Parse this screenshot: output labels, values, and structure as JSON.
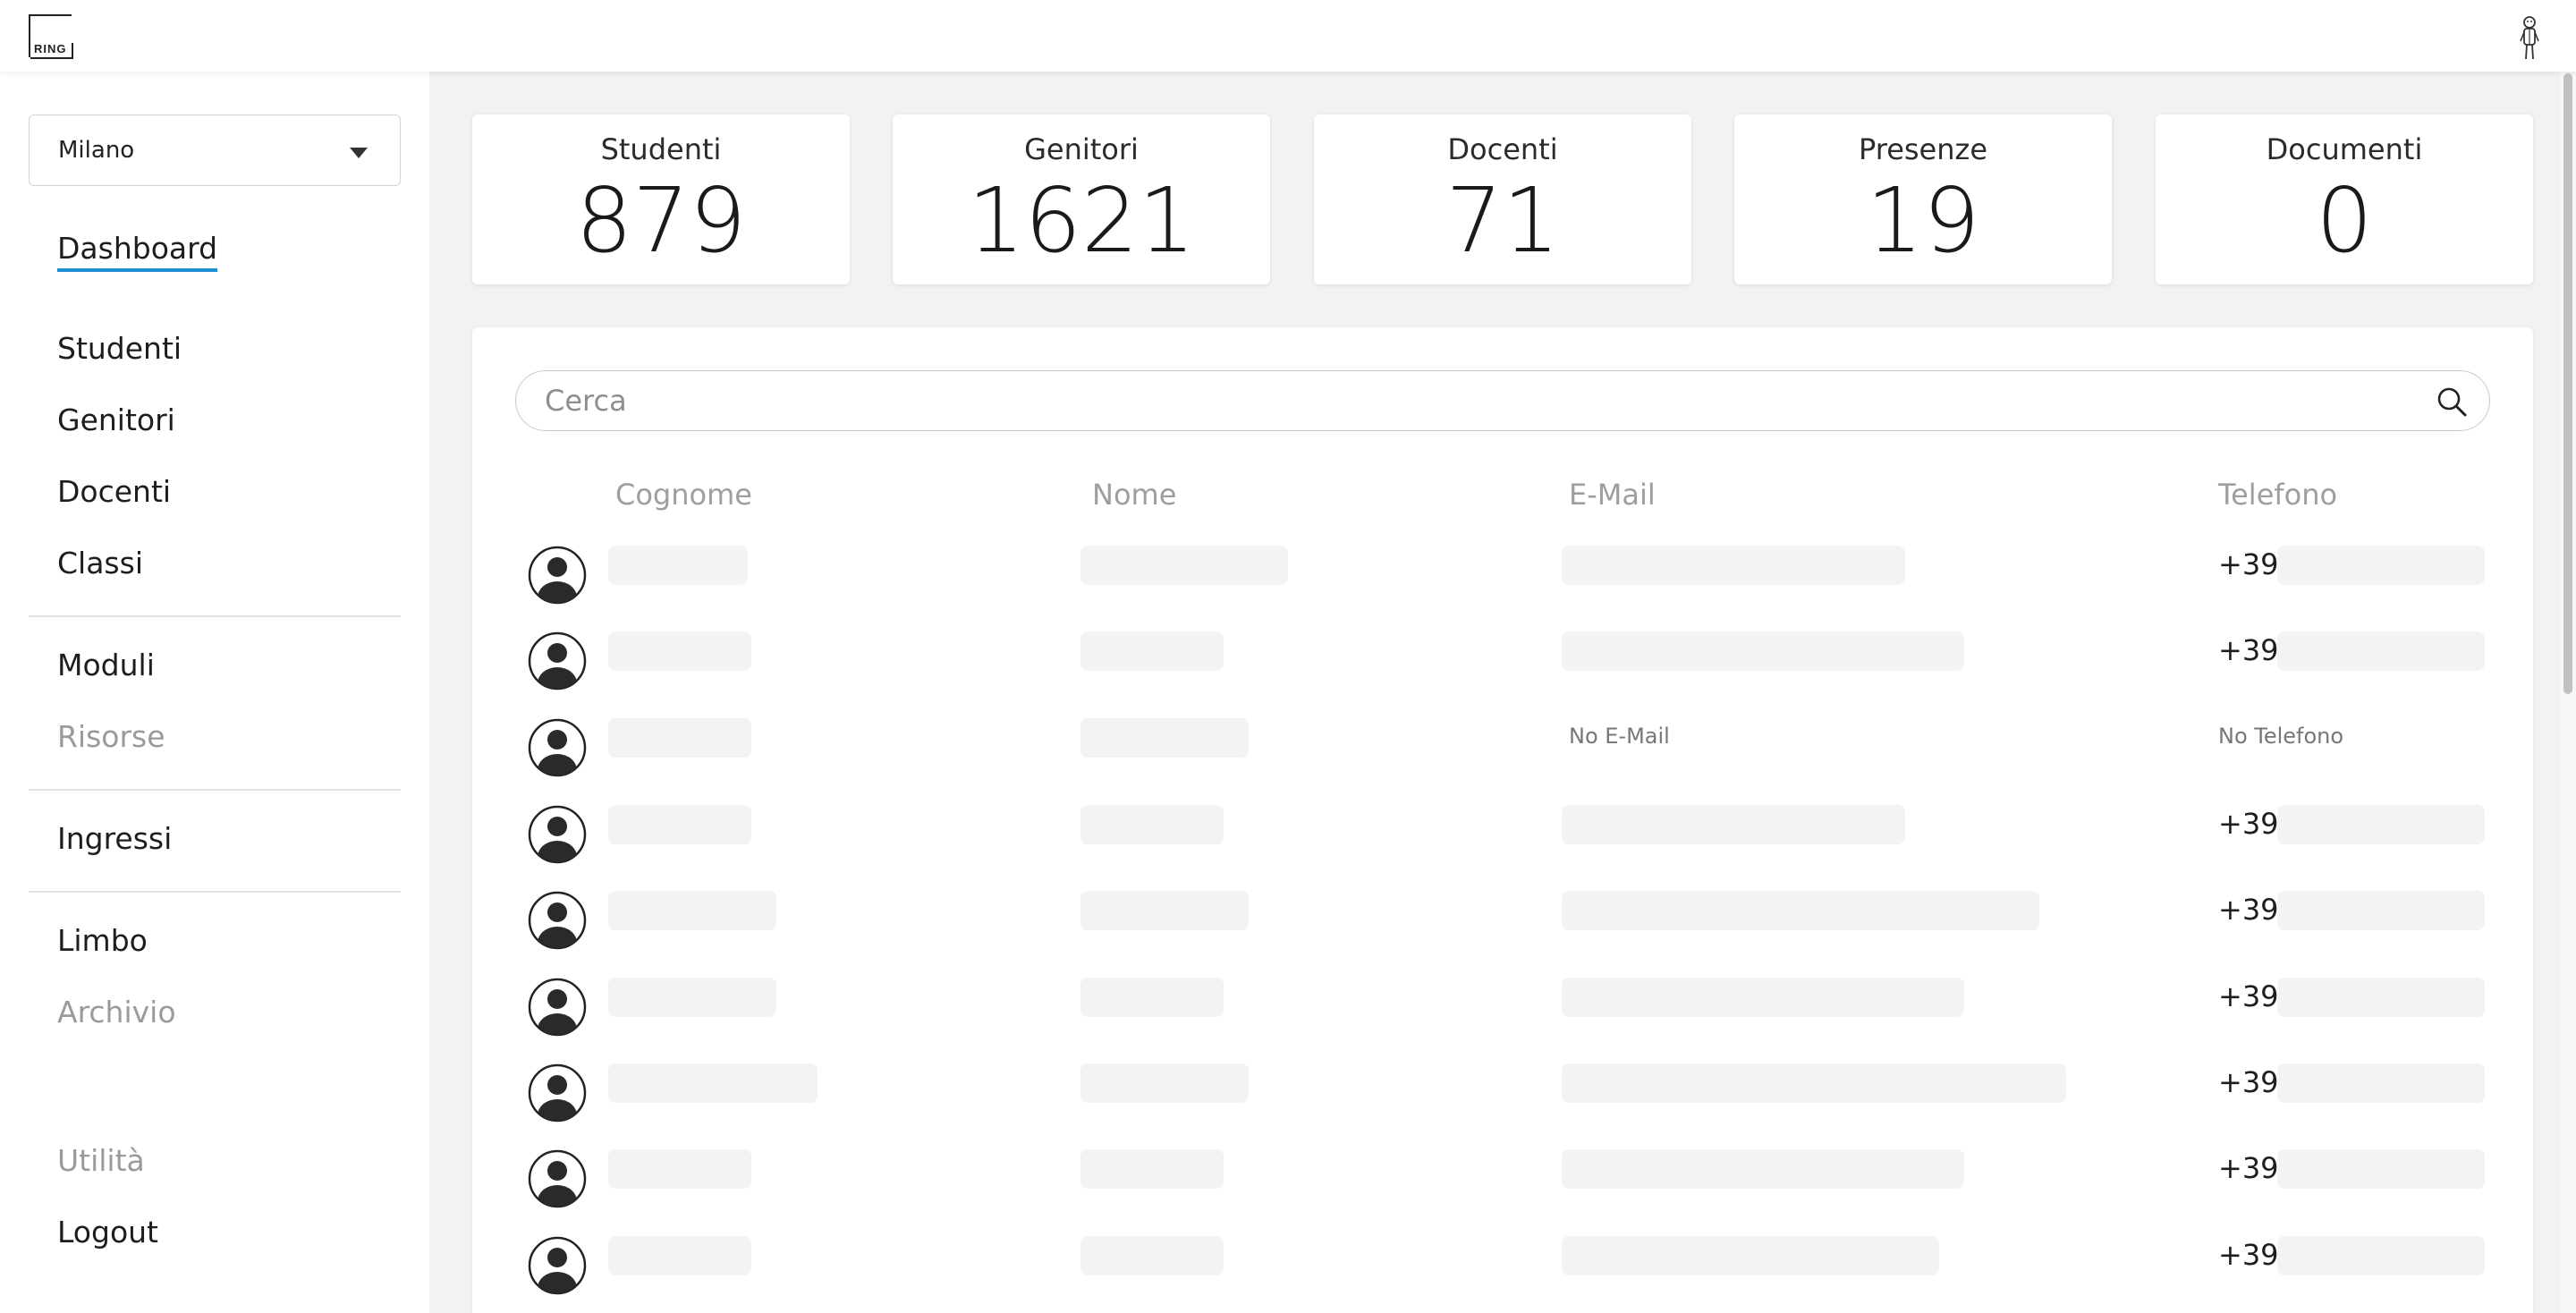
{
  "header": {
    "logo_text": "RING"
  },
  "sidebar": {
    "city": "Milano",
    "items": [
      {
        "label": "Dashboard"
      },
      {
        "label": "Studenti"
      },
      {
        "label": "Genitori"
      },
      {
        "label": "Docenti"
      },
      {
        "label": "Classi"
      },
      {
        "label": "Moduli"
      },
      {
        "label": "Risorse"
      },
      {
        "label": "Ingressi"
      },
      {
        "label": "Limbo"
      },
      {
        "label": "Archivio"
      },
      {
        "label": "Utilità"
      },
      {
        "label": "Logout"
      }
    ]
  },
  "stats": [
    {
      "label": "Studenti",
      "value": "879"
    },
    {
      "label": "Genitori",
      "value": "1621"
    },
    {
      "label": "Docenti",
      "value": "71"
    },
    {
      "label": "Presenze",
      "value": "19"
    },
    {
      "label": "Documenti",
      "value": "0"
    }
  ],
  "search": {
    "placeholder": "Cerca"
  },
  "table": {
    "columns": [
      "Cognome",
      "Nome",
      "E-Mail",
      "Telefono"
    ],
    "rows": [
      {
        "email": "",
        "phone_prefix": "+39"
      },
      {
        "email": "",
        "phone_prefix": "+39"
      },
      {
        "email": "No E-Mail",
        "phone_prefix": "No Telefono"
      },
      {
        "email": "",
        "phone_prefix": "+39"
      },
      {
        "email": "",
        "phone_prefix": "+39"
      },
      {
        "email": "",
        "phone_prefix": "+39"
      },
      {
        "email": "",
        "phone_prefix": "+39"
      },
      {
        "email": "",
        "phone_prefix": "+39"
      },
      {
        "email": "",
        "phone_prefix": "+39"
      }
    ]
  },
  "colors": {
    "accent": "#1b8fd1",
    "page_bg": "#f2f2f2",
    "skeleton": "#f3f3f3"
  }
}
